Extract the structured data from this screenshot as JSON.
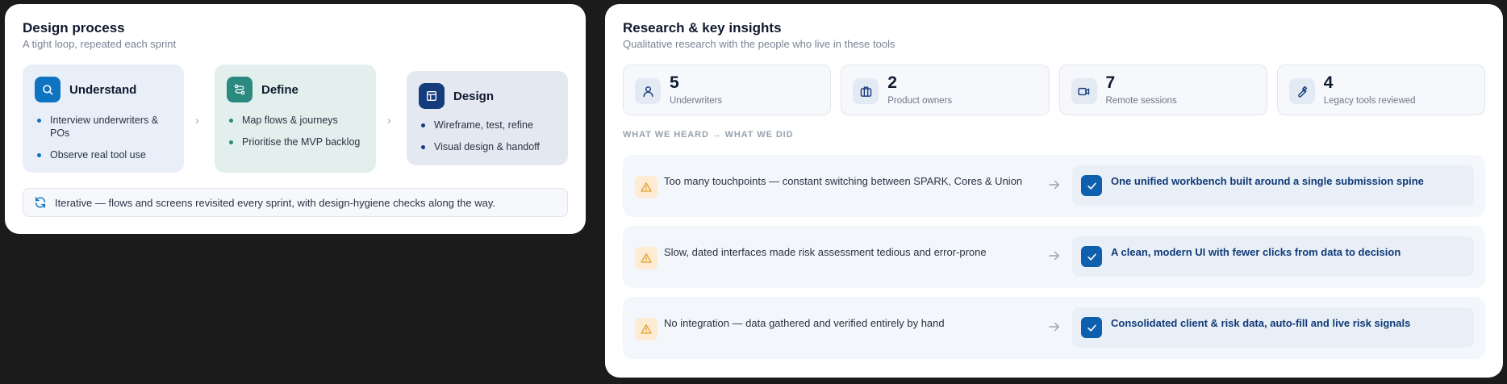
{
  "design_process": {
    "title": "Design process",
    "subtitle": "A tight loop, repeated each sprint",
    "steps": [
      {
        "name": "Understand",
        "icon": "search-icon",
        "items": [
          "Interview underwriters & POs",
          "Observe real tool use"
        ]
      },
      {
        "name": "Define",
        "icon": "flow-icon",
        "items": [
          "Map flows & journeys",
          "Prioritise the MVP backlog"
        ]
      },
      {
        "name": "Design",
        "icon": "layout-icon",
        "items": [
          "Wireframe, test, refine",
          "Visual design & handoff"
        ]
      }
    ],
    "chevron": "›",
    "iterative": "Iterative — flows and screens revisited every sprint, with design-hygiene checks along the way."
  },
  "research": {
    "title": "Research & key insights",
    "subtitle": "Qualitative research with the people who live in these tools",
    "stats": [
      {
        "value": "5",
        "label": "Underwriters",
        "icon": "user-icon"
      },
      {
        "value": "2",
        "label": "Product owners",
        "icon": "briefcase-icon"
      },
      {
        "value": "7",
        "label": "Remote sessions",
        "icon": "video-icon"
      },
      {
        "value": "4",
        "label": "Legacy tools reviewed",
        "icon": "wrench-icon"
      }
    ],
    "section_label": "WHAT WE HEARD → WHAT WE DID",
    "insights": [
      {
        "heard": "Too many touchpoints — constant switching between SPARK, Cores & Union",
        "did": "One unified workbench built around a single submission spine"
      },
      {
        "heard": "Slow, dated interfaces made risk assessment tedious and error-prone",
        "did": "A clean, modern UI with fewer clicks from data to decision"
      },
      {
        "heard": "No integration — data gathered and verified entirely by hand",
        "did": "Consolidated client & risk data, auto-fill and live risk signals"
      }
    ]
  },
  "colors": {
    "understand_accent": "#0e73c0",
    "define_accent": "#2b8a7f",
    "design_accent": "#173c7e",
    "warning_accent": "#e0a22e",
    "did_text": "#113a78"
  }
}
